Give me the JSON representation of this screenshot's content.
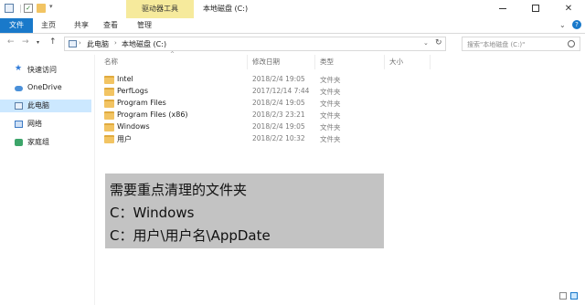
{
  "window": {
    "context_tab": "驱动器工具",
    "title": "本地磁盘 (C:)"
  },
  "ribbon": {
    "tabs": [
      "文件",
      "主页",
      "共享",
      "查看",
      "管理"
    ]
  },
  "address": {
    "crumbs": [
      "此电脑",
      "本地磁盘 (C:)"
    ],
    "search_placeholder": "搜索\"本地磁盘 (C:)\""
  },
  "sidebar": {
    "items": [
      {
        "label": "快速访问",
        "icon": "star-icon"
      },
      {
        "label": "OneDrive",
        "icon": "cloud-icon"
      },
      {
        "label": "此电脑",
        "icon": "computer-icon",
        "selected": true
      },
      {
        "label": "网络",
        "icon": "network-icon"
      },
      {
        "label": "家庭组",
        "icon": "homegroup-icon"
      }
    ]
  },
  "columns": {
    "name": "名称",
    "date": "修改日期",
    "type": "类型",
    "size": "大小"
  },
  "files": [
    {
      "name": "Intel",
      "date": "2018/2/4 19:05",
      "type": "文件夹"
    },
    {
      "name": "PerfLogs",
      "date": "2017/12/14 7:44",
      "type": "文件夹"
    },
    {
      "name": "Program Files",
      "date": "2018/2/4 19:05",
      "type": "文件夹"
    },
    {
      "name": "Program Files (x86)",
      "date": "2018/2/3 23:21",
      "type": "文件夹"
    },
    {
      "name": "Windows",
      "date": "2018/2/4 19:05",
      "type": "文件夹"
    },
    {
      "name": "用户",
      "date": "2018/2/2 10:32",
      "type": "文件夹"
    }
  ],
  "overlay": {
    "line1": "需要重点清理的文件夹",
    "line2": "C：Windows",
    "line3": "C：用户\\用户名\\AppDate"
  },
  "colors": {
    "accent": "#1979ca",
    "context_tab": "#f6ea9c",
    "selected": "#cce8ff",
    "folder": "#f2c463",
    "overlay": "#c3c3c3"
  }
}
